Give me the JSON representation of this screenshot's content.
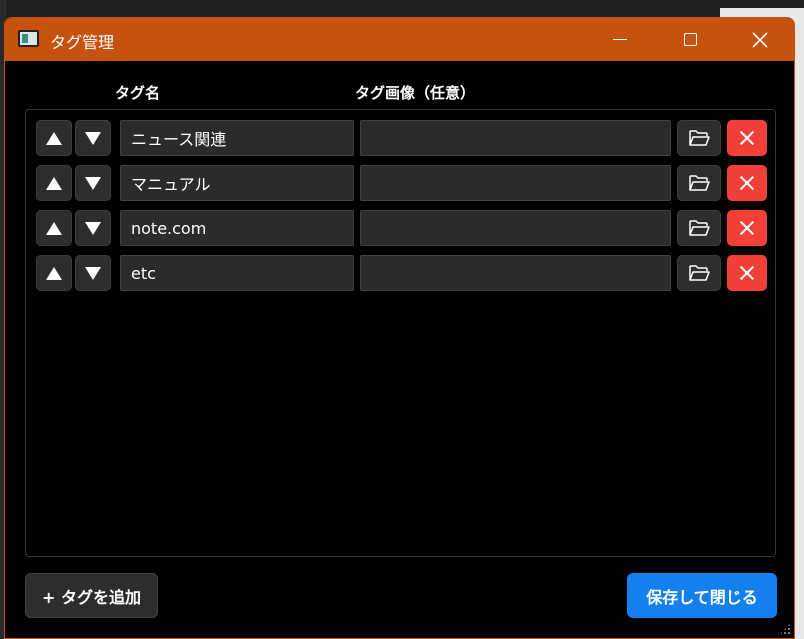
{
  "window": {
    "title": "タグ管理",
    "controls": {
      "minimize": "minimize",
      "maximize": "maximize",
      "close": "close"
    }
  },
  "columns": {
    "name_header": "タグ名",
    "image_header": "タグ画像（任意）"
  },
  "tags": [
    {
      "name": "ニュース関連",
      "image": ""
    },
    {
      "name": "マニュアル",
      "image": ""
    },
    {
      "name": "note.com",
      "image": ""
    },
    {
      "name": "etc",
      "image": ""
    }
  ],
  "footer": {
    "add_label": "+ タグを追加",
    "save_label": "保存して閉じる"
  },
  "colors": {
    "titlebar": "#c5520f",
    "delete": "#f04038",
    "primary": "#1480f0"
  },
  "icons": {
    "up": "triangle-up-icon",
    "down": "triangle-down-icon",
    "folder": "folder-open-icon",
    "delete": "close-icon"
  }
}
